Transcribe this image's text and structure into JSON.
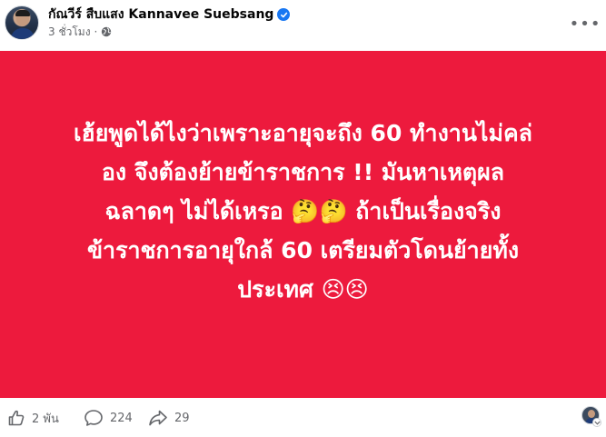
{
  "post": {
    "author": "กัณวีร์ สืบแสง Kannavee Suebsang",
    "timestamp": "3 ชั่วโมง",
    "separator": "·",
    "audience_icon": "globe-icon",
    "more_label": "•••"
  },
  "banner": {
    "background": "#ed1a3d",
    "text_color": "#ffffff",
    "lines": [
      "เฮ้ยพูดได้ไงว่าเพราะอายุจะถึง 60 ทำงานไม่คล่",
      "อง จึงต้องย้ายข้าราชการ !! มันหาเหตุผล",
      "ฉลาดๆ ไม่ได้เหรอ 🤔🤔 ถ้าเป็นเรื่องจริง",
      "ข้าราชการอายุใกล้ 60 เตรียมตัวโดนย้ายทั้ง",
      "ประเทศ 😣😣"
    ]
  },
  "actions": {
    "likes": "2 พัน",
    "comments": "224",
    "shares": "29"
  },
  "colors": {
    "accent": "#1877f2",
    "secondary_text": "#65676b"
  }
}
